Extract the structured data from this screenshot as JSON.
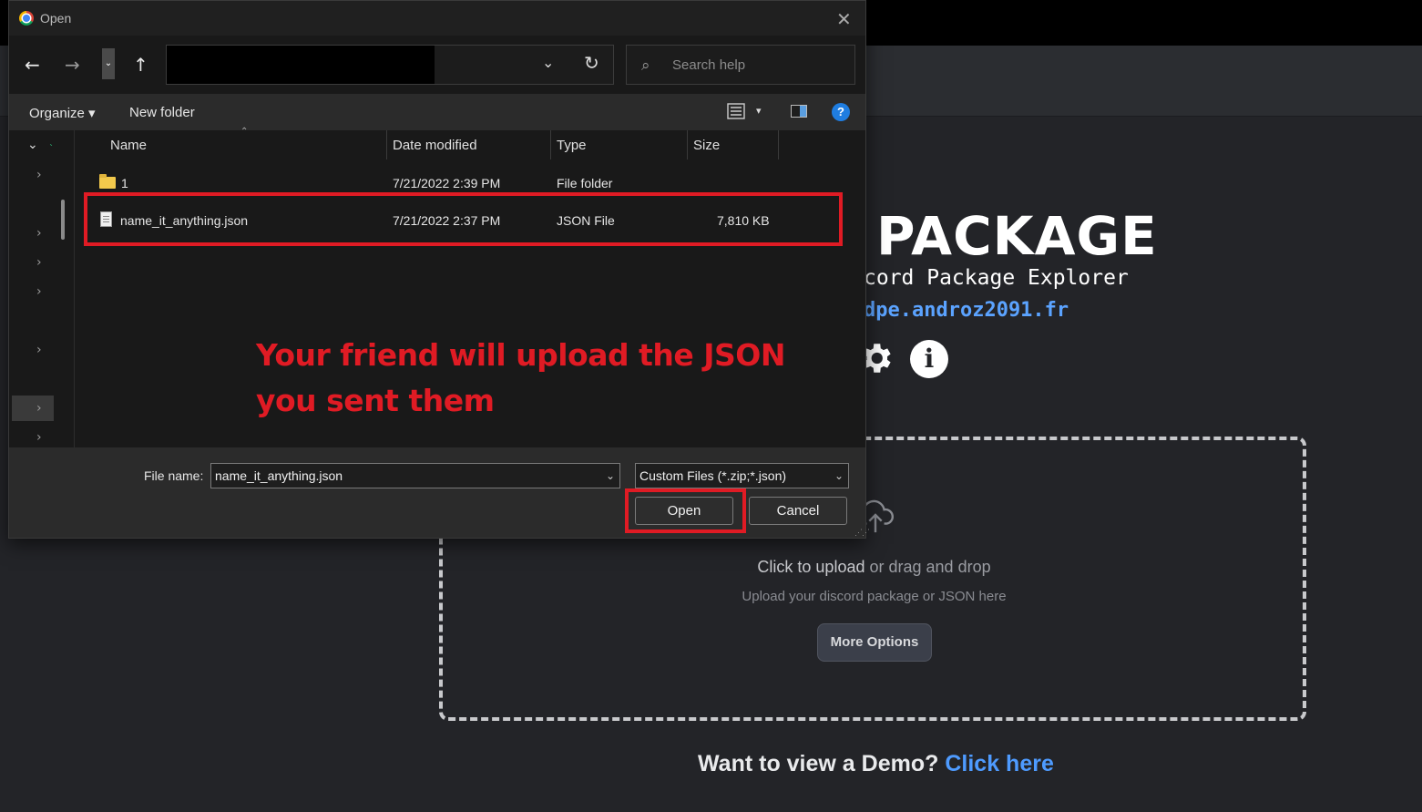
{
  "background_page": {
    "title": "PACKAGE",
    "subtitle": "cord Package Explorer",
    "link": "dpe.androz2091.fr",
    "settings_icon": "gear-icon",
    "info_icon": "info-icon",
    "info_glyph": "i",
    "upload": {
      "icon": "cloud-upload-icon",
      "click_text": "Click to upload",
      "rest_text": "or drag and drop",
      "sub_text": "Upload your discord package or JSON here",
      "more_options_label": "More Options"
    },
    "demo": {
      "text": "Want to view a Demo?",
      "link_text": "Click here"
    }
  },
  "dialog": {
    "title": "Open",
    "nav": {
      "back_glyph": "←",
      "forward_glyph": "→",
      "recent_glyph": "⌄",
      "up_glyph": "↑",
      "address_chevron": "⌄",
      "refresh_glyph": "↻",
      "search_placeholder": "Search help"
    },
    "commands": {
      "organize_label": "Organize ▾",
      "new_folder_label": "New folder",
      "view_caret": "▾",
      "help_glyph": "?"
    },
    "columns": {
      "name": "Name",
      "date_modified": "Date modified",
      "type": "Type",
      "size": "Size"
    },
    "files": [
      {
        "name": "1",
        "date": "7/21/2022 2:39 PM",
        "type": "File folder",
        "size": ""
      },
      {
        "name": "name_it_anything.json",
        "date": "7/21/2022 2:37 PM",
        "type": "JSON File",
        "size": "7,810 KB"
      }
    ],
    "annotation": {
      "line1": "Your friend will  upload the JSON",
      "line2": "you sent them"
    },
    "footer": {
      "file_name_label": "File name:",
      "file_name_value": "name_it_anything.json",
      "file_type_value": "Custom Files (*.zip;*.json)",
      "open_label": "Open",
      "cancel_label": "Cancel"
    }
  },
  "colors": {
    "annotation_red": "#e01b24",
    "link_blue": "#4e9bff",
    "page_bg": "#232428"
  }
}
